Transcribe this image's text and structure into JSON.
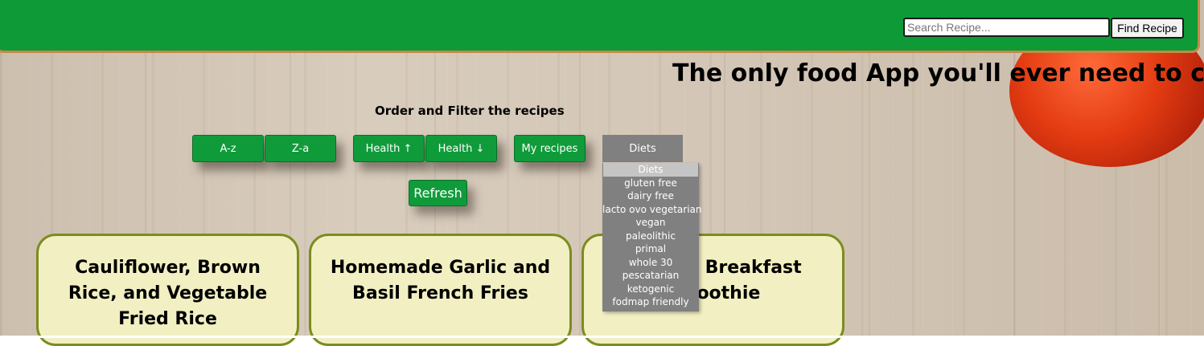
{
  "header": {
    "search_placeholder": "Search Recipe...",
    "search_value": "",
    "find_button": "Find Recipe"
  },
  "tagline": "The only food App you'll ever need to cook.",
  "filters": {
    "heading": "Order and Filter the recipes",
    "buttons": [
      "A-z",
      "Z-a",
      "Health ↑",
      "Health ↓",
      "My recipes"
    ],
    "diets_label": "Diets",
    "diet_options": [
      "Diets",
      "gluten free",
      "dairy free",
      "lacto ovo vegetarian",
      "vegan",
      "paleolithic",
      "primal",
      "whole 30",
      "pescatarian",
      "ketogenic",
      "fodmap friendly"
    ],
    "refresh": "Refresh"
  },
  "recipes": [
    {
      "title": "Cauliflower, Brown Rice, and Vegetable Fried Rice"
    },
    {
      "title": "Homemade Garlic and Basil French Fries"
    },
    {
      "title": "Banana Breakfast Smoothie"
    }
  ],
  "colors": {
    "navbar": "#0e9a37",
    "button_green": "#109b3a",
    "card_bg": "#f2f0c2",
    "card_border": "#7b8c1f",
    "dropdown_gray": "#808080"
  }
}
